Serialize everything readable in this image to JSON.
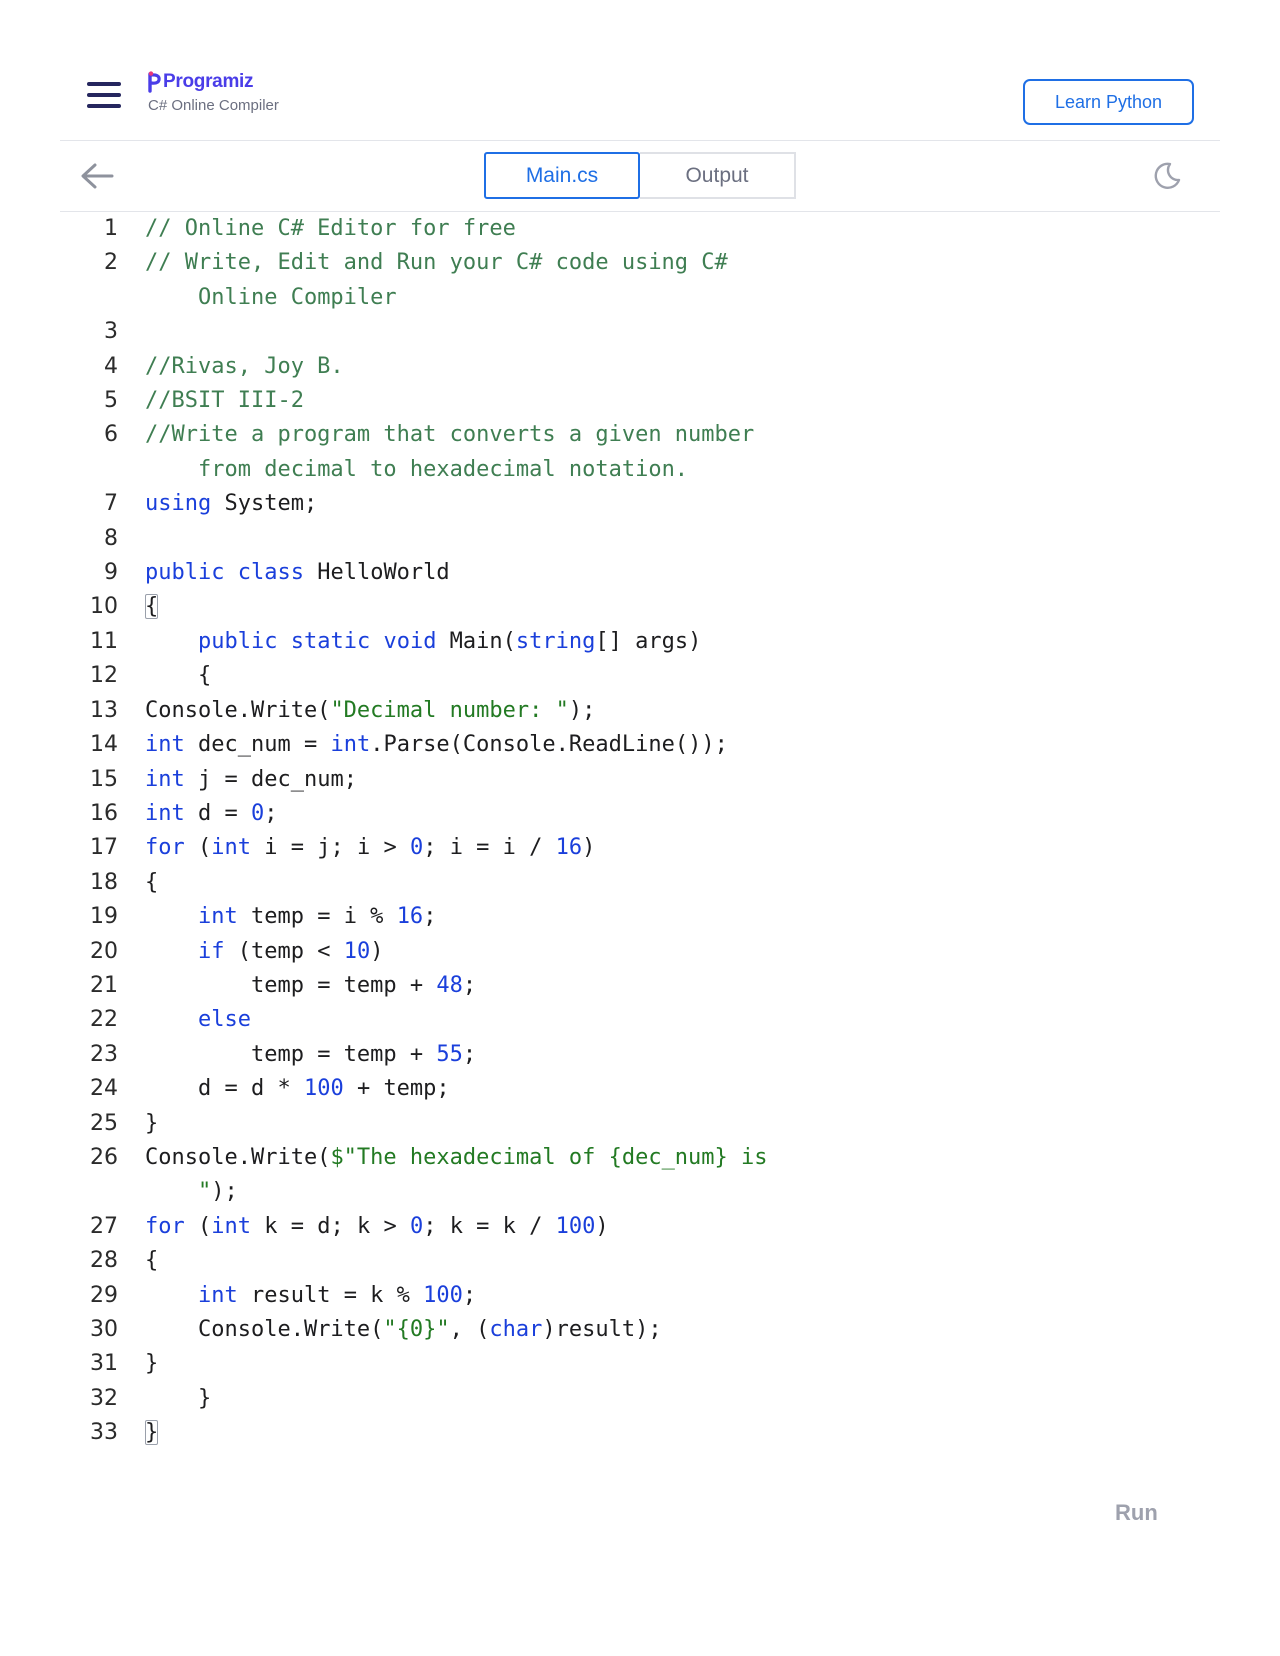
{
  "header": {
    "logo_text": "Programiz",
    "subtitle": "C# Online Compiler",
    "learn_label": "Learn Python"
  },
  "tabs": {
    "main_label": "Main.cs",
    "output_label": "Output"
  },
  "run_label": "Run",
  "code": {
    "ln": [
      "1",
      "2",
      "",
      "3",
      "4",
      "5",
      "6",
      "",
      "7",
      "8",
      "9",
      "10",
      "11",
      "12",
      "13",
      "14",
      "15",
      "16",
      "17",
      "18",
      "19",
      "20",
      "21",
      "22",
      "23",
      "24",
      "25",
      "26",
      "",
      "27",
      "28",
      "29",
      "30",
      "31",
      "32",
      "33"
    ],
    "t0": "// Online C# Editor for free",
    "t1": "// Write, Edit and Run your C# code using C#",
    "t1b": "Online Compiler",
    "t3": "//Rivas, Joy B.",
    "t4": "//BSIT III-2",
    "t5": "//Write a program that converts a given number",
    "t5b": "from decimal to hexadecimal notation.",
    "t6k": "using",
    "t6a": " System;",
    "t8k1": "public",
    "t8k2": "class",
    "t8a": " HelloWorld",
    "brace_open": "{",
    "brace_close": "}",
    "t10k1": "public",
    "t10k2": "static",
    "t10k3": "void",
    "t10a": " Main(",
    "t10k4": "string",
    "t10b": "[] args)",
    "t12a": "Console.Write(",
    "t12s": "\"Decimal number: \"",
    "t12b": ");",
    "t13k1": "int",
    "t13a": " dec_num = ",
    "t13k2": "int",
    "t13b": ".Parse(Console.ReadLine());",
    "t14k": "int",
    "t14a": " j = dec_num;",
    "t15k": "int",
    "t15a": " d = ",
    "t15n": "0",
    "t15b": ";",
    "t16k1": "for",
    "t16a": " (",
    "t16k2": "int",
    "t16b": " i = j; i > ",
    "t16n1": "0",
    "t16c": "; i = i / ",
    "t16n2": "16",
    "t16d": ")",
    "t18k": "int",
    "t18a": " temp = i % ",
    "t18n": "16",
    "t18b": ";",
    "t19k": "if",
    "t19a": " (temp < ",
    "t19n": "10",
    "t19b": ")",
    "t20a": "temp = temp + ",
    "t20n": "48",
    "t20b": ";",
    "t21k": "else",
    "t22a": "temp = temp + ",
    "t22n": "55",
    "t22b": ";",
    "t23a": "d = d * ",
    "t23n": "100",
    "t23b": " + temp;",
    "t25a": "Console.Write(",
    "t25s": "$\"The hexadecimal of {dec_num} is",
    "t25s2": "\"",
    "t25b": ");",
    "t26k1": "for",
    "t26a": " (",
    "t26k2": "int",
    "t26b": " k = d; k > ",
    "t26n1": "0",
    "t26c": "; k = k / ",
    "t26n2": "100",
    "t26d": ")",
    "t28k": "int",
    "t28a": " result = k % ",
    "t28n": "100",
    "t28b": ";",
    "t29a": "Console.Write(",
    "t29s": "\"{0}\"",
    "t29b": ", (",
    "t29k": "char",
    "t29c": ")result);"
  },
  "colors": {
    "accent": "#1f6fe5",
    "brand": "#4a3de8",
    "comment": "#3f7e52",
    "keyword": "#1a3fdb",
    "string": "#237a23"
  }
}
